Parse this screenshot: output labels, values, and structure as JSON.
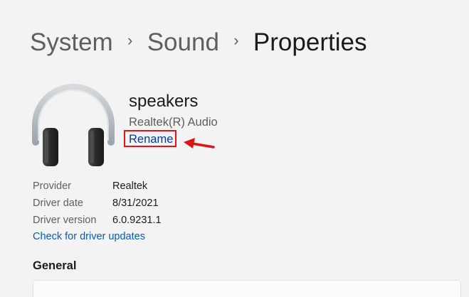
{
  "breadcrumb": {
    "items": [
      "System",
      "Sound"
    ],
    "separator": "›",
    "current": "Properties"
  },
  "device": {
    "icon": "headphones-icon",
    "name": "speakers",
    "description": "Realtek(R) Audio",
    "rename_label": "Rename"
  },
  "properties": [
    {
      "label": "Provider",
      "value": "Realtek"
    },
    {
      "label": "Driver date",
      "value": "8/31/2021"
    },
    {
      "label": "Driver version",
      "value": "6.0.9231.1"
    }
  ],
  "driver_update_link": "Check for driver updates",
  "sections": {
    "general_title": "General"
  },
  "colors": {
    "background": "#f3f3f3",
    "link": "#0a5ab4",
    "annotation_red": "#e01414"
  }
}
